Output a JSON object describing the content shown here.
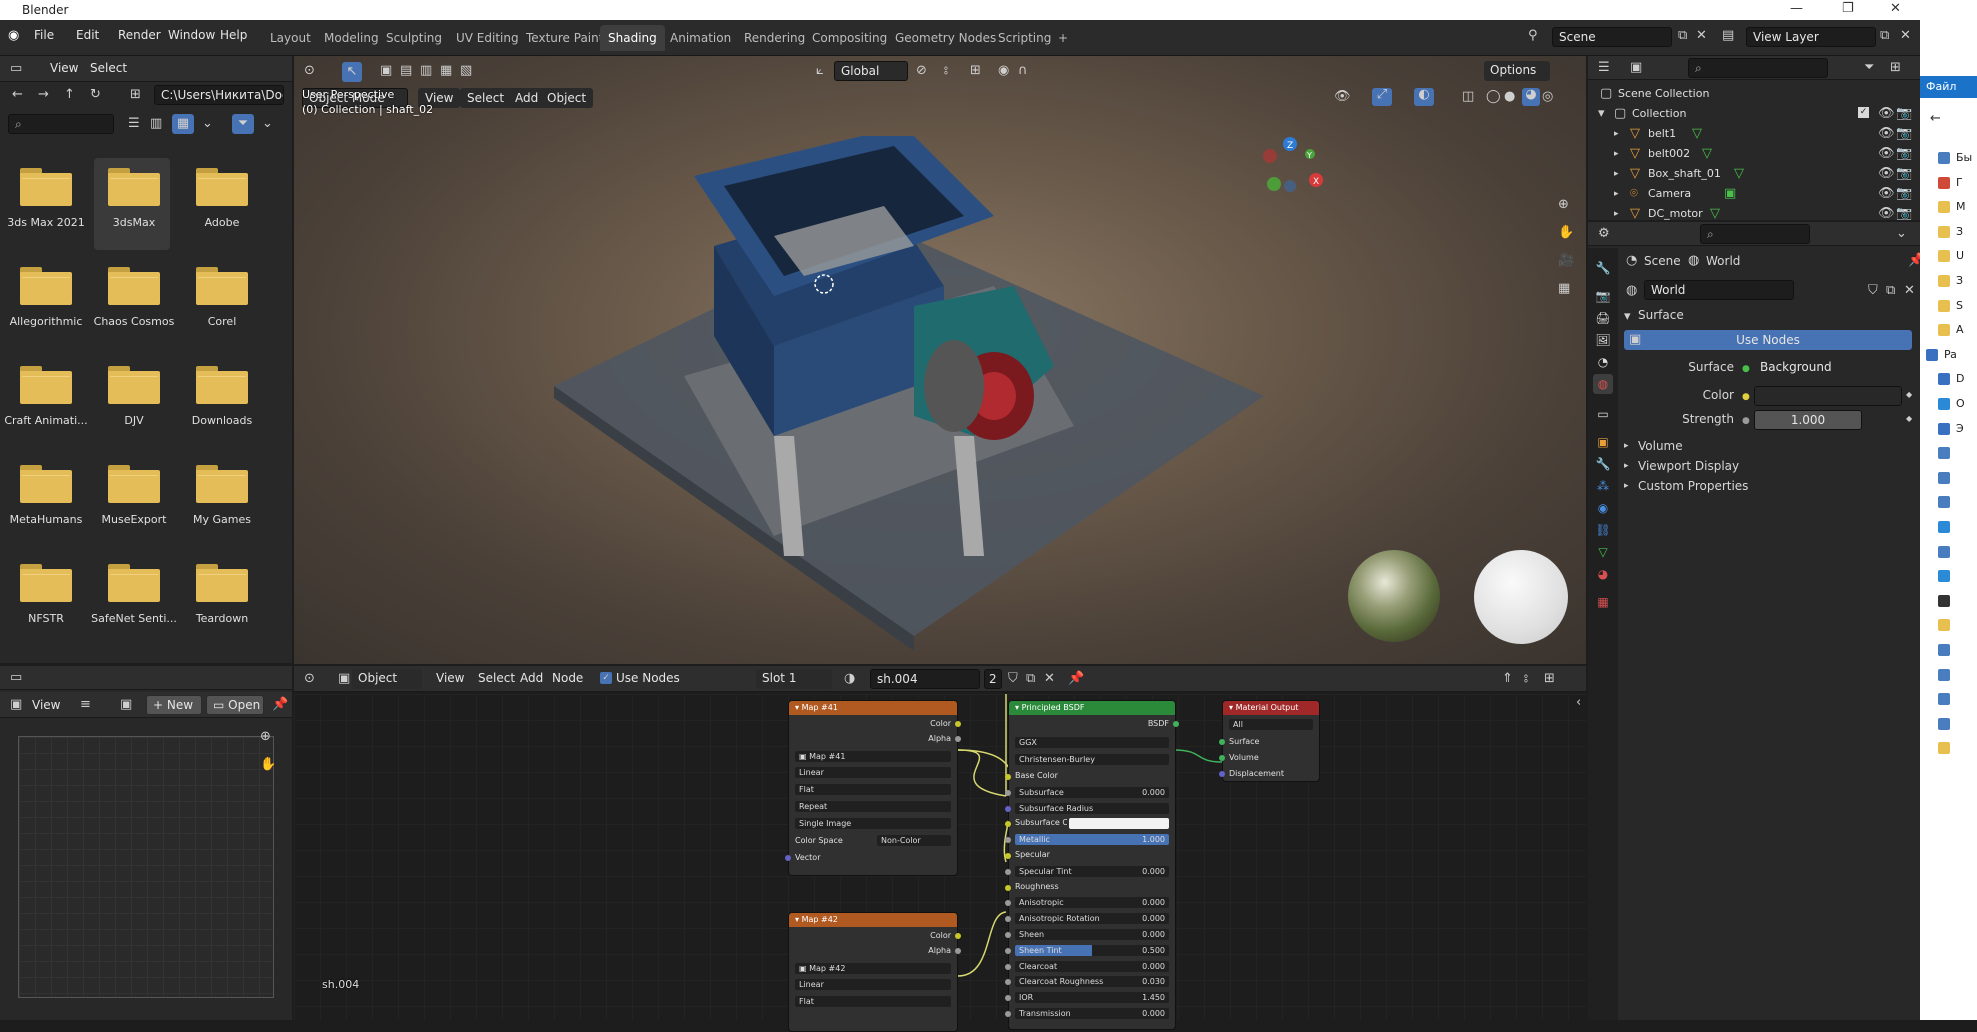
{
  "window": {
    "title": "Blender"
  },
  "menu": [
    "File",
    "Edit",
    "Render",
    "Window",
    "Help"
  ],
  "workspaces": {
    "tabs": [
      "Layout",
      "Modeling",
      "Sculpting",
      "UV Editing",
      "Texture Paint",
      "Shading",
      "Animation",
      "Rendering",
      "Compositing",
      "Geometry Nodes",
      "Scripting",
      "+"
    ],
    "active": "Shading"
  },
  "scene": {
    "name": "Scene",
    "view_layer": "View Layer"
  },
  "file_browser": {
    "header_menu": [
      "View",
      "Select"
    ],
    "path": "C:\\Users\\Никита\\Doc...",
    "search_placeholder": "",
    "items": [
      {
        "label": "3ds Max 2021"
      },
      {
        "label": "3dsMax"
      },
      {
        "label": "Adobe"
      },
      {
        "label": "Allegorithmic"
      },
      {
        "label": "Chaos Cosmos"
      },
      {
        "label": "Corel"
      },
      {
        "label": "Craft Animati..."
      },
      {
        "label": "DJV"
      },
      {
        "label": "Downloads"
      },
      {
        "label": "MetaHumans"
      },
      {
        "label": "MuseExport"
      },
      {
        "label": "My Games"
      },
      {
        "label": "NFSTR"
      },
      {
        "label": "SafeNet Senti..."
      },
      {
        "label": "Teardown"
      }
    ],
    "selected": "3dsMax"
  },
  "image_editor": {
    "view": "View",
    "new": "New",
    "open": "Open"
  },
  "viewport": {
    "mode": "Object Mode",
    "menus": [
      "View",
      "Select",
      "Add",
      "Object"
    ],
    "orientation": "Global",
    "options": "Options",
    "info_line1": "User Perspective",
    "info_line2": "(0) Collection | shaft_02",
    "gizmo": {
      "x": "X",
      "y": "Y",
      "z": "Z"
    }
  },
  "node_editor": {
    "type": "Object",
    "menus": [
      "View",
      "Select",
      "Add",
      "Node"
    ],
    "use_nodes": "Use Nodes",
    "slot": "Slot 1",
    "material": "sh.004",
    "users": "2",
    "footer_label": "sh.004",
    "nodes": {
      "map41": {
        "title": "Map #41",
        "out_color": "Color",
        "out_alpha": "Alpha",
        "image": "Map #41",
        "interp": "Linear",
        "proj": "Flat",
        "ext": "Repeat",
        "source": "Single Image",
        "cs_label": "Color Space",
        "cs_value": "Non-Color",
        "in_vector": "Vector"
      },
      "map42": {
        "title": "Map #42",
        "out_color": "Color",
        "out_alpha": "Alpha",
        "image": "Map #42",
        "interp": "Linear",
        "proj": "Flat"
      },
      "bsdf": {
        "title": "Principled BSDF",
        "out": "BSDF",
        "dist": "GGX",
        "sss_method": "Christensen-Burley",
        "rows": [
          {
            "label": "Base Color",
            "value": "",
            "kind": "socket"
          },
          {
            "label": "Subsurface",
            "value": "0.000",
            "kind": "field"
          },
          {
            "label": "Subsurface Radius",
            "value": "",
            "kind": "dropdown"
          },
          {
            "label": "Subsurface Col...",
            "value": "",
            "kind": "color"
          },
          {
            "label": "Metallic",
            "value": "1.000",
            "kind": "slider",
            "fill": 1.0
          },
          {
            "label": "Specular",
            "value": "",
            "kind": "socket"
          },
          {
            "label": "Specular Tint",
            "value": "0.000",
            "kind": "field"
          },
          {
            "label": "Roughness",
            "value": "",
            "kind": "socket"
          },
          {
            "label": "Anisotropic",
            "value": "0.000",
            "kind": "field"
          },
          {
            "label": "Anisotropic Rotation",
            "value": "0.000",
            "kind": "field"
          },
          {
            "label": "Sheen",
            "value": "0.000",
            "kind": "field"
          },
          {
            "label": "Sheen Tint",
            "value": "0.500",
            "kind": "slider",
            "fill": 0.5
          },
          {
            "label": "Clearcoat",
            "value": "0.000",
            "kind": "field"
          },
          {
            "label": "Clearcoat Roughness",
            "value": "0.030",
            "kind": "field"
          },
          {
            "label": "IOR",
            "value": "1.450",
            "kind": "field"
          },
          {
            "label": "Transmission",
            "value": "0.000",
            "kind": "field"
          }
        ]
      },
      "output": {
        "title": "Material Output",
        "target": "All",
        "in_surface": "Surface",
        "in_volume": "Volume",
        "in_disp": "Displacement"
      }
    }
  },
  "outliner": {
    "root": "Scene Collection",
    "collection": "Collection",
    "objects": [
      "belt1",
      "belt002",
      "Box_shaft_01",
      "Camera",
      "DC_motor"
    ]
  },
  "properties": {
    "breadcrumb_scene": "Scene",
    "breadcrumb_world": "World",
    "world_name": "World",
    "surface_panel": "Surface",
    "use_nodes": "Use Nodes",
    "surface_label": "Surface",
    "surface_value": "Background",
    "color_label": "Color",
    "strength_label": "Strength",
    "strength_value": "1.000",
    "panels": [
      "Volume",
      "Viewport Display",
      "Custom Properties"
    ]
  },
  "explorer": {
    "file_btn": "Файл",
    "rows": [
      "Бы",
      "Г",
      "М",
      "З",
      "U",
      "З",
      "S",
      "A",
      "Pa",
      "D",
      "O",
      "Э",
      "",
      "",
      "",
      "",
      "",
      "",
      "",
      "",
      "",
      "",
      "",
      "",
      ""
    ]
  },
  "colors": {
    "accent": "#4772b3",
    "bsdf_header": "#2a8a3a",
    "map_header": "#b05a22",
    "output_header": "#a02828",
    "folder": "#e4bd58"
  }
}
